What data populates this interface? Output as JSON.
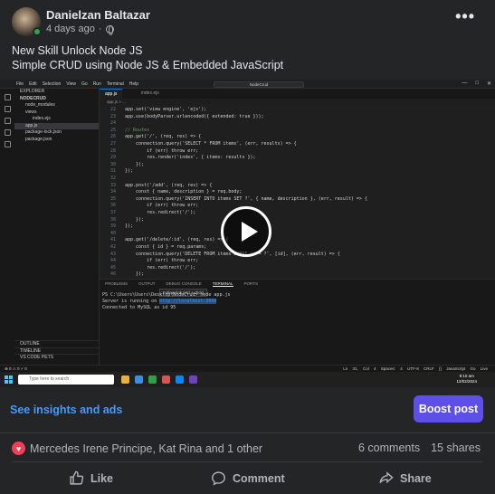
{
  "post": {
    "author": "Danielzan Baltazar",
    "time": "4 days ago",
    "dot": "·",
    "more": "•••",
    "line1": "New Skill Unlock Node JS",
    "line2": "Simple CRUD using Node JS & Embedded JavaScript"
  },
  "vscode": {
    "menus": [
      "File",
      "Edit",
      "Selection",
      "View",
      "Go",
      "Run",
      "Terminal",
      "Help"
    ],
    "command_center": "NodeCrud",
    "window_controls": [
      "—",
      "□",
      "✕"
    ],
    "explorer_title": "EXPLORER",
    "project": "NODECRUD",
    "files": [
      "node_modules",
      "views",
      "index.ejs",
      "app.js",
      "package-lock.json",
      "package.json"
    ],
    "outline": "OUTLINE",
    "timeline": "TIMELINE",
    "npm_scripts": "VS CODE PETS",
    "tabs": [
      "app.js",
      "index.ejs"
    ],
    "breadcrumb": "app.js > ...",
    "code_lines": [
      {
        "n": "22",
        "t": "app.set('view engine', 'ejs');"
      },
      {
        "n": "23",
        "t": "app.use(bodyParser.urlencoded({ extended: true }));"
      },
      {
        "n": "24",
        "t": ""
      },
      {
        "n": "25",
        "t": "// Routes"
      },
      {
        "n": "26",
        "t": "app.get('/', (req, res) => {"
      },
      {
        "n": "27",
        "t": "    connection.query('SELECT * FROM items', (err, results) => {"
      },
      {
        "n": "28",
        "t": "        if (err) throw err;"
      },
      {
        "n": "29",
        "t": "        res.render('index', { items: results });"
      },
      {
        "n": "30",
        "t": "    });"
      },
      {
        "n": "31",
        "t": "});"
      },
      {
        "n": "32",
        "t": ""
      },
      {
        "n": "33",
        "t": "app.post('/add', (req, res) => {"
      },
      {
        "n": "34",
        "t": "    const { name, description } = req.body;"
      },
      {
        "n": "35",
        "t": "    connection.query('INSERT INTO items SET ?', { name, description }, (err, result) => {"
      },
      {
        "n": "36",
        "t": "        if (err) throw err;"
      },
      {
        "n": "37",
        "t": "        res.redirect('/');"
      },
      {
        "n": "38",
        "t": "    });"
      },
      {
        "n": "39",
        "t": "});"
      },
      {
        "n": "40",
        "t": ""
      },
      {
        "n": "41",
        "t": "app.get('/delete/:id', (req, res) => {"
      },
      {
        "n": "42",
        "t": "    const { id } = req.params;"
      },
      {
        "n": "43",
        "t": "    connection.query('DELETE FROM items WHERE id = ?', [id], (err, result) => {"
      },
      {
        "n": "44",
        "t": "        if (err) throw err;"
      },
      {
        "n": "45",
        "t": "        res.redirect('/');"
      },
      {
        "n": "46",
        "t": "    });"
      }
    ],
    "panel_tabs": [
      "PROBLEMS",
      "OUTPUT",
      "DEBUG CONSOLE",
      "TERMINAL",
      "PORTS"
    ],
    "tooltip": "Follow link (ctrl + click)",
    "term_line1": "PS C:\\Users\\Users\\Desktop\\NodeCrud> node app.js",
    "term_line2a": "Server is running on ",
    "term_link": "http://localhost:3000",
    "term_line3": "Connected to MySQL as id 95",
    "status_left": "⊗ 0 ⚠ 0   ⚡ 0",
    "status_right": "Ln 31, Col 4  Spaces: 4  UTF-8  CRLF  {} JavaScript  Go Live",
    "search_placeholder": "Type here to search",
    "clock_time": "9:10 am",
    "clock_date": "12/02/2024"
  },
  "insights": {
    "link": "See insights and ads",
    "boost": "Boost post"
  },
  "engagement": {
    "reactors": "Mercedes Irene Principe, Kat Rina and 1 other",
    "comments": "6 comments",
    "shares": "15 shares"
  },
  "actions": {
    "like": "Like",
    "comment": "Comment",
    "share": "Share"
  },
  "colors": {
    "accent": "#5e4fe8",
    "link": "#4599ff",
    "love": "#f33e58"
  }
}
